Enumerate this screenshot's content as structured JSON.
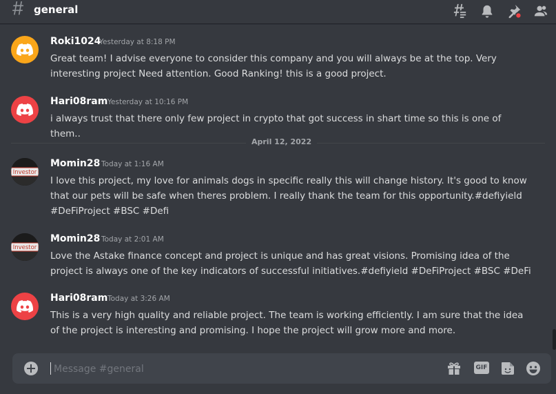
{
  "channel": {
    "name": "general"
  },
  "messages": [
    {
      "author": "Roki1024",
      "timestamp": "Yesterday at 8:18 PM",
      "lines": [
        "Great team! I advise everyone to consider this company and you will always be at the top. Very",
        "interesting project Need attention. Good Ranking! this is a good project."
      ],
      "avatar_color": "#faa61a"
    },
    {
      "author": "Hari08ram",
      "timestamp": "Yesterday at 10:16 PM",
      "lines": [
        "i always trust that there only few project in crypto that got success in shart time so this is one of them.."
      ],
      "avatar_color": "#ed4245"
    },
    {
      "author": "Momin28",
      "timestamp": "Today at 1:16 AM",
      "lines": [
        "I love this project, my love for animals dogs in specific really this will change history. It's good to know",
        "that our pets will be safe when theres problem. I really thank the team for this opportunity.#defiyield",
        "#DeFiProject #BSC #Defi"
      ],
      "avatar_label": "Investor"
    },
    {
      "author": "Momin28",
      "timestamp": "Today at 2:01 AM",
      "lines": [
        "Love the Astake finance concept and  project  is unique and has great visions. Promising idea of the",
        "project is always one of the key indicators of successful initiatives.#defiyield #DeFiProject #BSC #DeFi"
      ],
      "avatar_label": "Investor"
    },
    {
      "author": "Hari08ram",
      "timestamp": "Today at 3:26 AM",
      "lines": [
        "This is a very high quality and reliable project. The team is working efficiently. I am sure that the idea",
        "of the project is interesting and promising. I hope the project will grow more and more."
      ],
      "avatar_color": "#ed4245"
    }
  ],
  "date_divider": "April 12, 2022",
  "composer": {
    "placeholder": "Message #general",
    "gif_label": "GIF"
  },
  "colors": {
    "background": "#36393f",
    "composer": "#40444b",
    "notification_dot": "#ed4245"
  }
}
